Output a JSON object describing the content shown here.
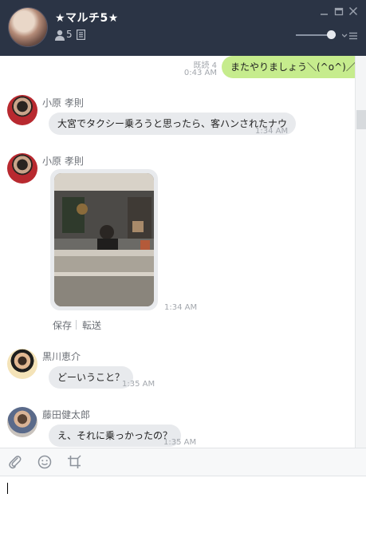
{
  "header": {
    "title": "★マルチ5★",
    "member_count": "5",
    "icons": [
      "person-icon",
      "note-icon",
      "minimize-icon",
      "maximize-icon",
      "close-icon",
      "volume-slider",
      "menu-icon"
    ],
    "background": "#2b3445"
  },
  "messages": {
    "m0": {
      "text": "またやりましょう＼(^o^)／",
      "read": "既読 4",
      "time": "0:43 AM",
      "outgoing": true
    },
    "m1": {
      "sender": "小原 孝則",
      "text": "大宮でタクシー乗ろうと思ったら、客ハンされたナウ",
      "time": "1:34 AM"
    },
    "m2": {
      "sender": "小原 孝則",
      "type": "photo",
      "time": "1:34 AM",
      "save": "保存",
      "forward": "転送"
    },
    "m3": {
      "sender": "黒川恵介",
      "text": "どーいうこと？",
      "time": "1:35 AM"
    },
    "m4": {
      "sender": "藤田健太郎",
      "text": "え、それに乗っかったの？",
      "time": "1:35 AM"
    }
  },
  "toolbar": {
    "icons": [
      "attach-icon",
      "emoji-icon",
      "crop-icon"
    ]
  },
  "colors": {
    "outgoing_bubble": "#c6ec8d",
    "incoming_bubble": "#e8eaed",
    "header": "#2b3445"
  }
}
